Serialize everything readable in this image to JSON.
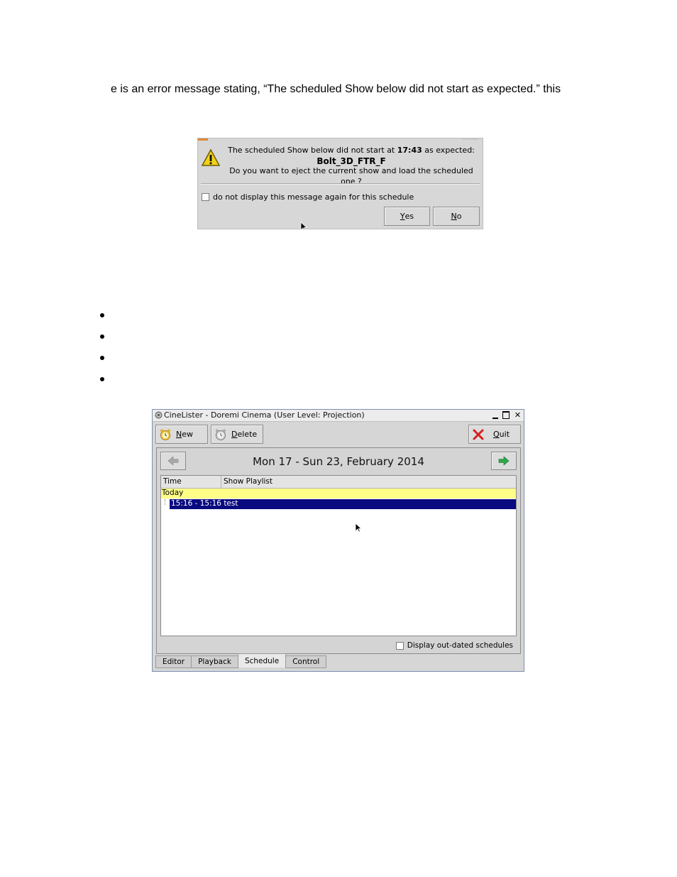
{
  "page": {
    "intro_text": "e is an error message stating, “The scheduled Show below did not start as expected.” this"
  },
  "dialog": {
    "line1_pre": "The scheduled Show below did not start at ",
    "time": "17:43",
    "line1_post": " as expected:",
    "show_name": "Bolt_3D_FTR_F",
    "question": "Do you want to eject the current show and load the scheduled one ?",
    "checkbox_label": "do not display this message again for this schedule",
    "yes_label": "es",
    "yes_mnemonic": "Y",
    "no_label": "o",
    "no_mnemonic": "N",
    "icons": {
      "warning": "warning-icon"
    }
  },
  "window": {
    "title": "CineLister - Doremi Cinema (User Level: Projection)",
    "toolbar": {
      "new_mnemonic": "N",
      "new_label": "ew",
      "delete_mnemonic": "D",
      "delete_label": "elete",
      "quit_mnemonic": "Q",
      "quit_label": "uit"
    },
    "week_title": "Mon 17 - Sun 23, February 2014",
    "columns": {
      "time": "Time",
      "playlist": "Show Playlist"
    },
    "group_label": "Today",
    "rows": [
      {
        "text": "15:16 - 15:16 test",
        "selected": true
      }
    ],
    "outdated_label": "Display out-dated schedules",
    "tabs": [
      {
        "label": "Editor",
        "active": false
      },
      {
        "label": "Playback",
        "active": false
      },
      {
        "label": "Schedule",
        "active": true
      },
      {
        "label": "Control",
        "active": false
      }
    ],
    "colors": {
      "today_row": "#ffff88",
      "selected_row": "#0a0a80"
    }
  }
}
